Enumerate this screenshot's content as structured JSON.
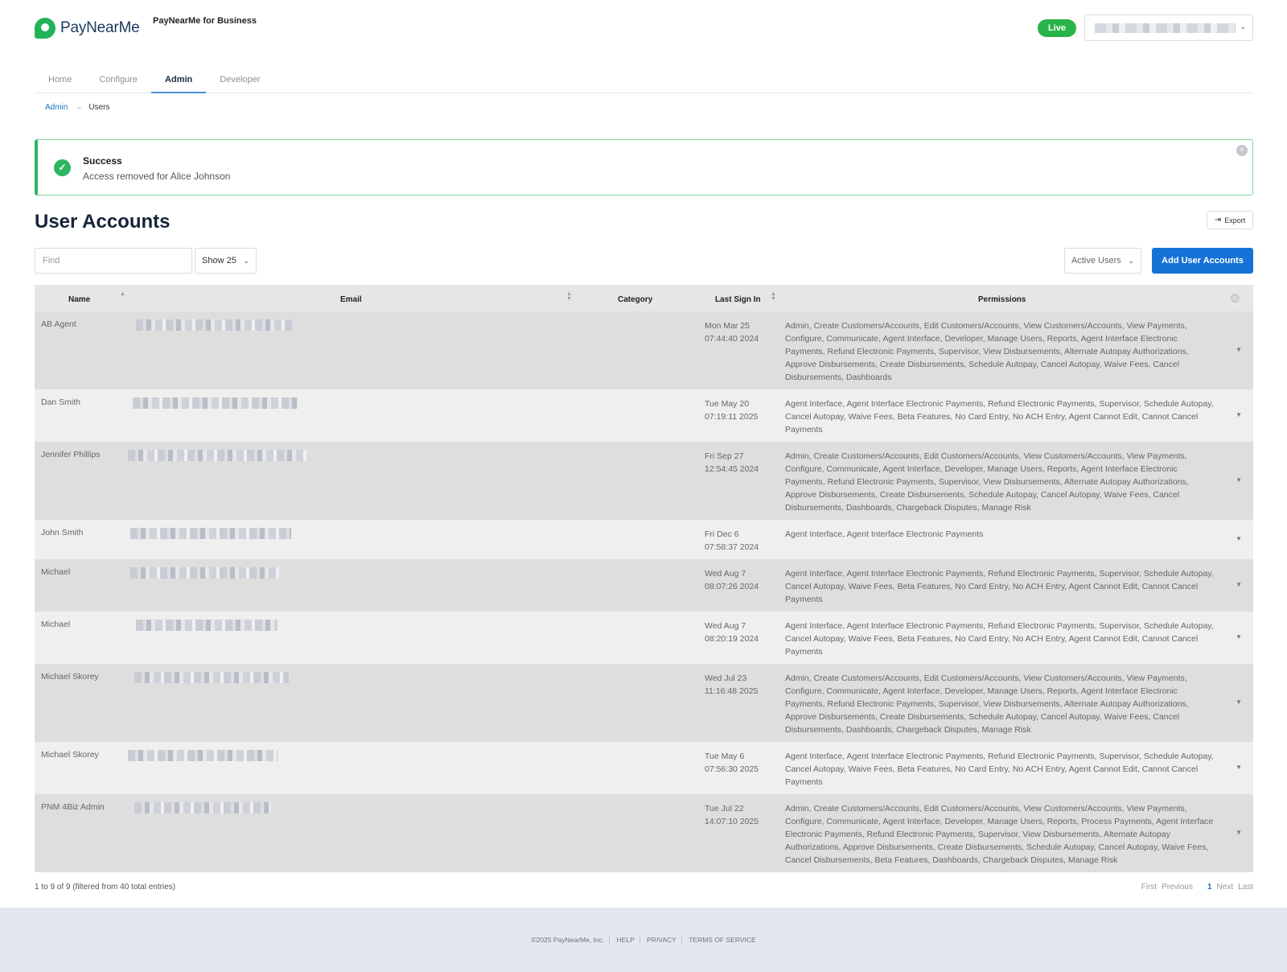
{
  "brand": {
    "name": "PayNearMe",
    "product": "PayNearMe for Business"
  },
  "header": {
    "env_badge": "Live"
  },
  "nav": {
    "tabs": [
      "Home",
      "Configure",
      "Admin",
      "Developer"
    ],
    "active": "Admin"
  },
  "breadcrumb": {
    "parent": "Admin",
    "separator": "→",
    "current": "Users"
  },
  "alert": {
    "title": "Success",
    "message": "Access removed for Alice Johnson"
  },
  "page": {
    "title": "User Accounts",
    "export_label": "Export"
  },
  "controls": {
    "find_placeholder": "Find",
    "show_value": "Show 25",
    "filter_value": "Active Users",
    "add_button": "Add User Accounts"
  },
  "table": {
    "columns": [
      "Name",
      "Email",
      "Category",
      "Last Sign In",
      "Permissions"
    ],
    "rows": [
      {
        "name": "AB Agent",
        "date1": "Mon Mar 25",
        "date2": "07:44:40 2024",
        "permissions": "Admin, Create Customers/Accounts, Edit Customers/Accounts, View Customers/Accounts, View Payments, Configure, Communicate, Agent Interface, Developer, Manage Users, Reports, Agent Interface Electronic Payments, Refund Electronic Payments, Supervisor, View Disbursements, Alternate Autopay Authorizations, Approve Disbursements, Create Disbursements, Schedule Autopay, Cancel Autopay, Waive Fees, Cancel Disbursements, Dashboards"
      },
      {
        "name": "Dan Smith",
        "date1": "Tue May 20",
        "date2": "07:19:11 2025",
        "permissions": "Agent Interface, Agent Interface Electronic Payments, Refund Electronic Payments, Supervisor, Schedule Autopay, Cancel Autopay, Waive Fees, Beta Features, No Card Entry, No ACH Entry, Agent Cannot Edit, Cannot Cancel Payments"
      },
      {
        "name": "Jennifer Phillips",
        "date1": "Fri Sep 27",
        "date2": "12:54:45 2024",
        "permissions": "Admin, Create Customers/Accounts, Edit Customers/Accounts, View Customers/Accounts, View Payments, Configure, Communicate, Agent Interface, Developer, Manage Users, Reports, Agent Interface Electronic Payments, Refund Electronic Payments, Supervisor, View Disbursements, Alternate Autopay Authorizations, Approve Disbursements, Create Disbursements, Schedule Autopay, Cancel Autopay, Waive Fees, Cancel Disbursements, Dashboards, Chargeback Disputes, Manage Risk"
      },
      {
        "name": "John Smith",
        "date1": "Fri Dec 6",
        "date2": "07:58:37 2024",
        "permissions": "Agent Interface, Agent Interface Electronic Payments"
      },
      {
        "name": "Michael",
        "date1": "Wed Aug 7",
        "date2": "08:07:26 2024",
        "permissions": "Agent Interface, Agent Interface Electronic Payments, Refund Electronic Payments, Supervisor, Schedule Autopay, Cancel Autopay, Waive Fees, Beta Features, No Card Entry, No ACH Entry, Agent Cannot Edit, Cannot Cancel Payments"
      },
      {
        "name": "Michael",
        "date1": "Wed Aug 7",
        "date2": "08:20:19 2024",
        "permissions": "Agent Interface, Agent Interface Electronic Payments, Refund Electronic Payments, Supervisor, Schedule Autopay, Cancel Autopay, Waive Fees, Beta Features, No Card Entry, No ACH Entry, Agent Cannot Edit, Cannot Cancel Payments"
      },
      {
        "name": "Michael Skorey",
        "date1": "Wed Jul 23",
        "date2": "11:16:48 2025",
        "permissions": "Admin, Create Customers/Accounts, Edit Customers/Accounts, View Customers/Accounts, View Payments, Configure, Communicate, Agent Interface, Developer, Manage Users, Reports, Agent Interface Electronic Payments, Refund Electronic Payments, Supervisor, View Disbursements, Alternate Autopay Authorizations, Approve Disbursements, Create Disbursements, Schedule Autopay, Cancel Autopay, Waive Fees, Cancel Disbursements, Dashboards, Chargeback Disputes, Manage Risk"
      },
      {
        "name": "Michael Skorey",
        "date1": "Tue May 6",
        "date2": "07:56:30 2025",
        "permissions": "Agent Interface, Agent Interface Electronic Payments, Refund Electronic Payments, Supervisor, Schedule Autopay, Cancel Autopay, Waive Fees, Beta Features, No Card Entry, No ACH Entry, Agent Cannot Edit, Cannot Cancel Payments"
      },
      {
        "name": "PNM 4Biz Admin",
        "date1": "Tue Jul 22",
        "date2": "14:07:10 2025",
        "permissions": "Admin, Create Customers/Accounts, Edit Customers/Accounts, View Customers/Accounts, View Payments, Configure, Communicate, Agent Interface, Developer, Manage Users, Reports, Process Payments, Agent Interface Electronic Payments, Refund Electronic Payments, Supervisor, View Disbursements, Alternate Autopay Authorizations, Approve Disbursements, Create Disbursements, Schedule Autopay, Cancel Autopay, Waive Fees, Cancel Disbursements, Beta Features, Dashboards, Chargeback Disputes, Manage Risk"
      }
    ],
    "info": "1 to 9 of 9 (filtered from 40 total entries)",
    "pager": {
      "first": "First",
      "previous": "Previous",
      "current": "1",
      "next": "Next",
      "last": "Last"
    }
  },
  "footer": {
    "copyright": "©2025 PayNearMe, Inc.",
    "links": [
      "HELP",
      "PRIVACY",
      "TERMS OF SERVICE"
    ]
  },
  "icons": {
    "success": "check-circle-icon",
    "close": "close-circle-icon",
    "export": "export-icon",
    "settings": "gear-icon"
  },
  "colors": {
    "primary": "#1672d6",
    "success": "#2fb463",
    "live": "#29b34a"
  }
}
